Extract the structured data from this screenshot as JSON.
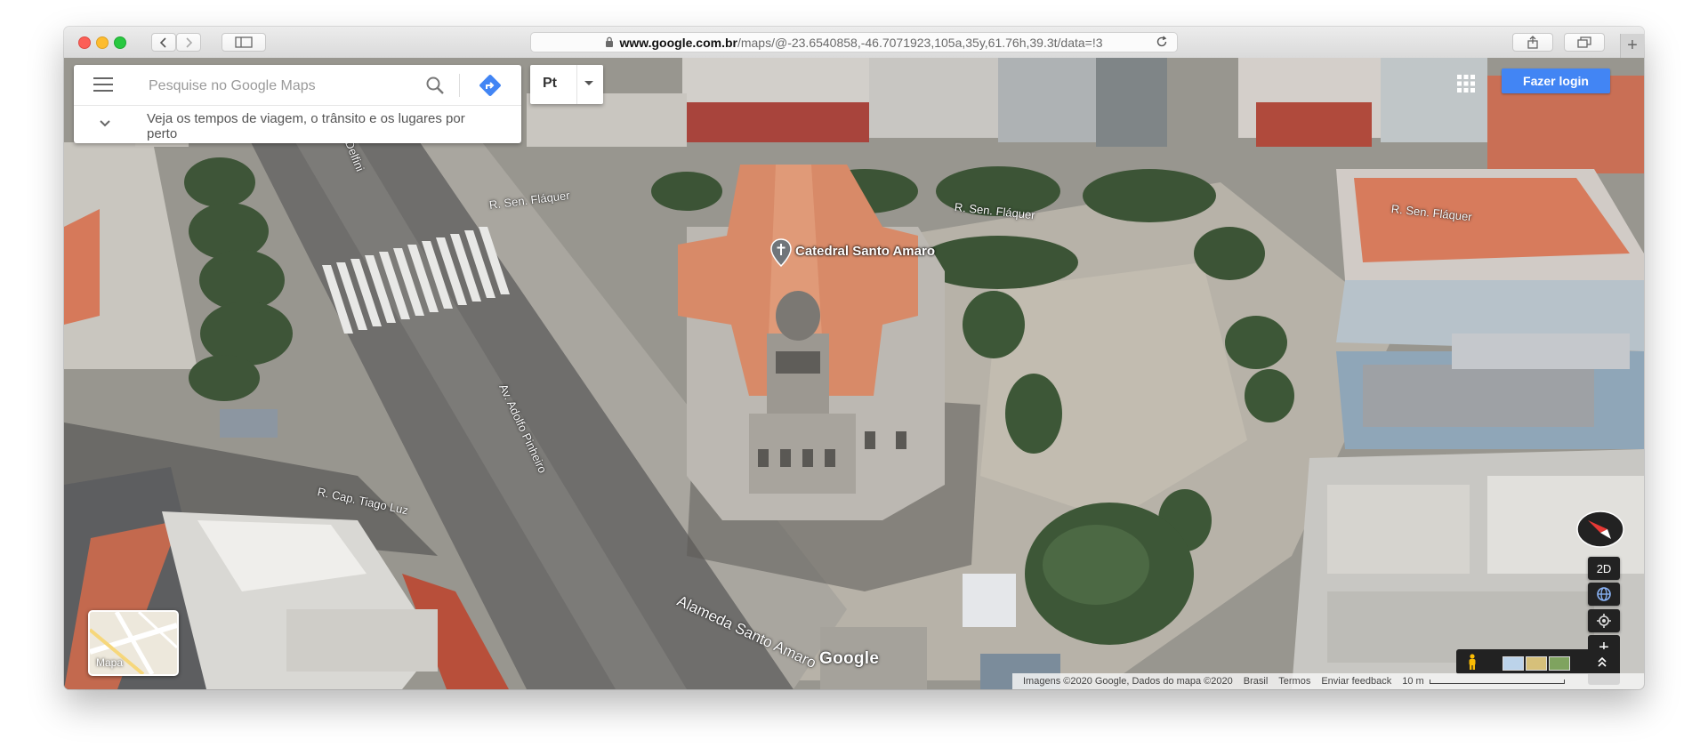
{
  "browser": {
    "url_domain": "www.google.com.br",
    "url_path": "/maps/@-23.6540858,-46.7071923,105a,35y,61.76h,39.3t/data=!3",
    "new_tab_label": "+"
  },
  "search": {
    "placeholder": "Pesquise no Google Maps",
    "travel_hint": "Veja os tempos de viagem, o trânsito e os lugares por perto"
  },
  "layer_button": {
    "label": "Pt"
  },
  "account": {
    "login_label": "Fazer login"
  },
  "poi": {
    "name": "Catedral Santo Amaro"
  },
  "streets": {
    "s1": "R. Sen. Fláquer",
    "s2": "R. Sen. Fláquer",
    "s3": "R. Sen. Fláquer",
    "s4": "Av. Adolfo Pinheiro",
    "s5": "R. Cap. Tiago Luz",
    "s6": "Alameda Santo Amaro",
    "s7": "Delfini"
  },
  "controls": {
    "mode_2d": "2D",
    "zoom_in": "+",
    "zoom_out": "−"
  },
  "minimap": {
    "label": "Mapa"
  },
  "brand": {
    "logo": "Google"
  },
  "footer": {
    "imagery": "Imagens ©2020 Google, Dados do mapa ©2020",
    "country": "Brasil",
    "terms": "Termos",
    "feedback": "Enviar feedback",
    "scale": "10 m"
  },
  "colors": {
    "accent": "#4285f4",
    "roof": "#d98a6a",
    "controls_bg": "#222222"
  }
}
